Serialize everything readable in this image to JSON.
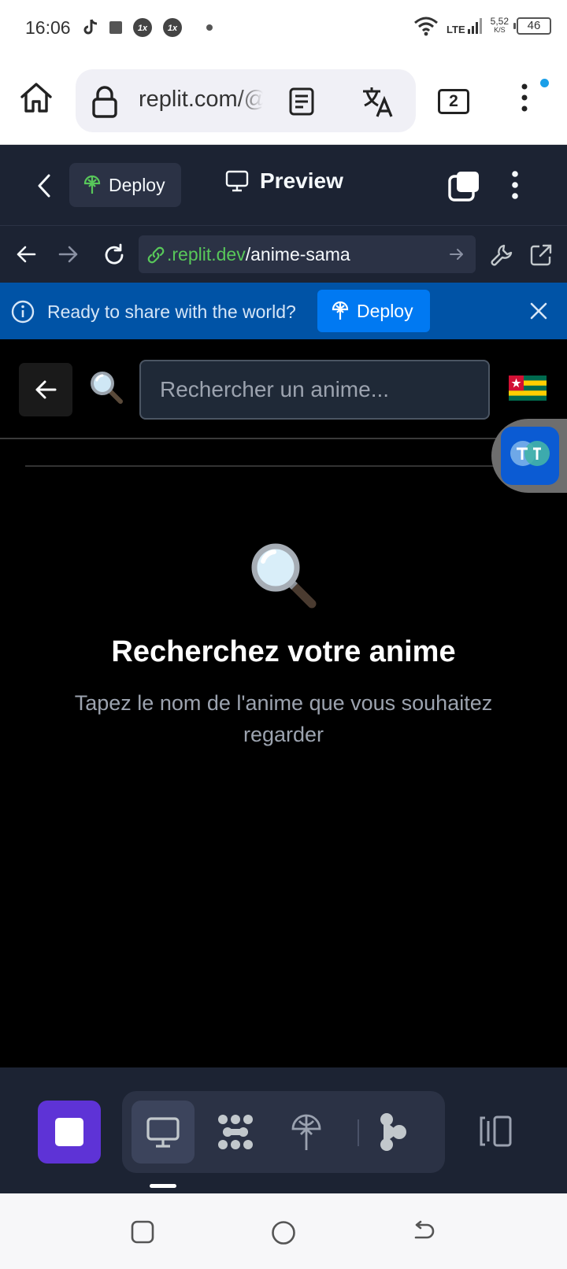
{
  "status_bar": {
    "time": "16:06",
    "network": "LTE",
    "speed_value": "5,52",
    "speed_unit": "K/S",
    "battery": "46",
    "icons": [
      "tiktok-icon",
      "square-notification-icon",
      "1x-app-icon",
      "1x-app-icon",
      "dot-icon",
      "wifi-icon",
      "signal-icon",
      "battery-icon"
    ]
  },
  "browser": {
    "url": "replit.com/@",
    "tab_count": "2",
    "icons": [
      "home-icon",
      "lock-icon",
      "reader-mode-icon",
      "translate-icon",
      "kebab-menu-icon"
    ],
    "notification_dot_color": "#1a9fe8"
  },
  "replit_header": {
    "deploy_label": "Deploy",
    "preview_label": "Preview"
  },
  "preview_toolbar": {
    "url_host": ".replit.dev",
    "url_path": "/anime-sama"
  },
  "deploy_banner": {
    "message": "Ready to share with the world?",
    "button_label": "Deploy",
    "background": "#0053a6",
    "button_color": "#0079f2"
  },
  "app": {
    "search_placeholder": "Rechercher un anime...",
    "search_value": "",
    "flag": "Togo",
    "empty_title": "Recherchez votre anime",
    "empty_subtitle": "Tapez le nom de l'anime que vous souhaitez regarder"
  },
  "bottom_bar": {
    "stop_color": "#5e33d6",
    "tools": [
      "preview-tool",
      "workflows-tool",
      "deployments-tool",
      "agent-tool"
    ],
    "layout_toggle": "layout-toggle-icon"
  },
  "android_nav": [
    "recents",
    "home",
    "back"
  ]
}
